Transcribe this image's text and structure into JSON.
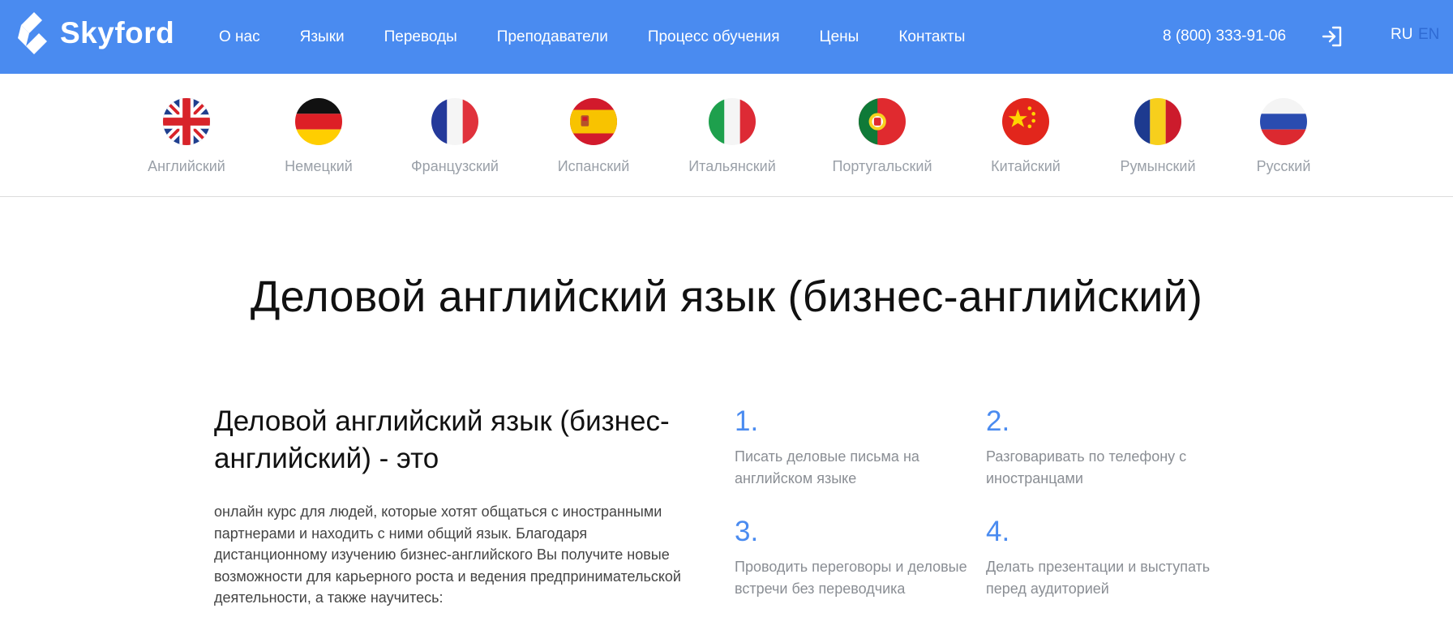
{
  "header": {
    "logo_text": "Skyford",
    "nav": [
      "О нас",
      "Языки",
      "Переводы",
      "Преподаватели",
      "Процесс обучения",
      "Цены",
      "Контакты"
    ],
    "phone": "8 (800) 333-91-06",
    "login_icon": "login-icon",
    "lang_ru": "RU",
    "lang_en": "EN"
  },
  "languages": [
    {
      "label": "Английский",
      "flag": "uk-flag-icon"
    },
    {
      "label": "Немецкий",
      "flag": "germany-flag-icon"
    },
    {
      "label": "Французский",
      "flag": "france-flag-icon"
    },
    {
      "label": "Испанский",
      "flag": "spain-flag-icon"
    },
    {
      "label": "Итальянский",
      "flag": "italy-flag-icon"
    },
    {
      "label": "Португальский",
      "flag": "portugal-flag-icon"
    },
    {
      "label": "Китайский",
      "flag": "china-flag-icon"
    },
    {
      "label": "Румынский",
      "flag": "romania-flag-icon"
    },
    {
      "label": "Русский",
      "flag": "russia-flag-icon"
    }
  ],
  "main": {
    "title": "Деловой английский язык (бизнес-английский)",
    "intro_title": "Деловой английский язык (бизнес-английский) - это",
    "intro_text": "онлайн курс для людей, которые хотят общаться с иностранными партнерами и находить с ними общий язык. Благодаря дистанционному изучению бизнес-английского Вы получите новые возможности для карьерного роста и ведения предпринимательской деятельности, а также научитесь:",
    "points": [
      {
        "num": "1.",
        "text": "Писать деловые письма на английском языке"
      },
      {
        "num": "2.",
        "text": "Разговаривать по телефону с иностранцами"
      },
      {
        "num": "3.",
        "text": "Проводить переговоры и деловые встречи без переводчика"
      },
      {
        "num": "4.",
        "text": "Делать презентации и выступать перед аудиторией"
      }
    ]
  },
  "colors": {
    "header_bg": "#4a8bf0",
    "accent": "#4a8bf0",
    "muted_text": "#9aa0a8"
  }
}
